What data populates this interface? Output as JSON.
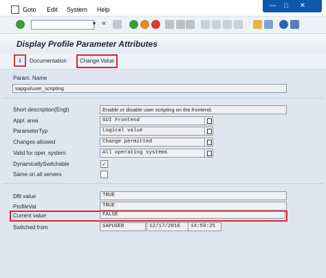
{
  "menu": {
    "items": [
      "Goto",
      "Edit",
      "System",
      "Help"
    ]
  },
  "window_controls": {
    "minimize": "—",
    "restore": "□",
    "close": "✕"
  },
  "toolbar": {
    "back_arrows": "«"
  },
  "page": {
    "title": "Display Profile Parameter Attributes"
  },
  "app_toolbar": {
    "documentation_label": "Documentation",
    "change_value_label": "Change Value"
  },
  "form": {
    "param_name_label": "Param. Name",
    "param_name_value": "sapgui/user_scripting",
    "short_desc_label": "Short description(Engl)",
    "short_desc_value": "Enable or disable user scripting on the frontend.",
    "appl_area_label": "Appl. area",
    "appl_area_value": "GUI Frontend",
    "param_type_label": "ParameterTyp",
    "param_type_value": "Logical value",
    "changes_allowed_label": "Changes allowed",
    "changes_allowed_value": "Change permitted",
    "valid_os_label": "Valid for oper. system",
    "valid_os_value": "All operating systems",
    "dyn_switch_label": "DynamicallySwitchable",
    "dyn_switch_checked": "✓",
    "same_servers_label": "Same on all servers",
    "same_servers_checked": "",
    "dflt_label": "Dflt value",
    "dflt_value": "TRUE",
    "profile_label": "ProfileVal",
    "profile_value": "TRUE",
    "current_label": "Current value",
    "current_value": "FALSE",
    "switched_label": "Switched from",
    "switched_user": "SAPUSER",
    "switched_date": "12/17/2016",
    "switched_time": "14:59:25"
  }
}
